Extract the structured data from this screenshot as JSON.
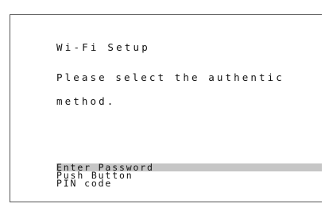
{
  "screen": {
    "title": "Wi-Fi Setup",
    "message_lines": [
      "Please select the authentic",
      "method."
    ]
  },
  "menu": {
    "items": [
      {
        "label": "Enter Password",
        "selected": true
      },
      {
        "label": "Push Button",
        "selected": false
      },
      {
        "label": "PIN code",
        "selected": false
      }
    ]
  },
  "colors": {
    "background": "#ffffff",
    "text": "#111111",
    "selection_highlight": "#c6c6c6",
    "border": "#555555"
  }
}
